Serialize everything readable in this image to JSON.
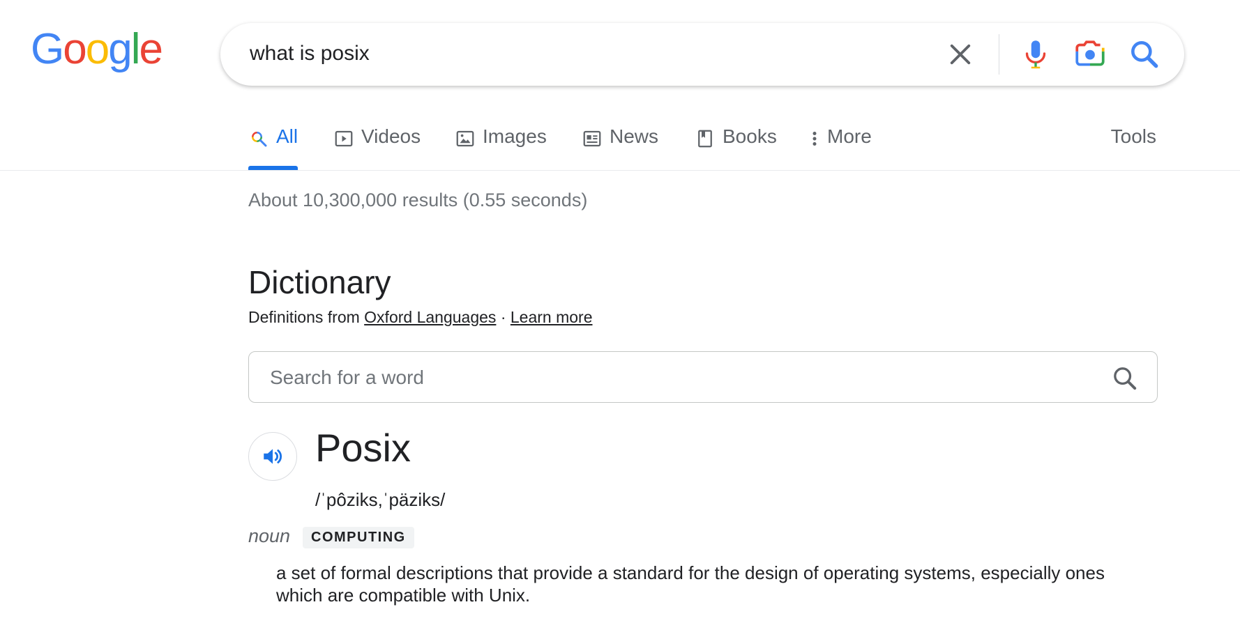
{
  "logo": {
    "text": "Google",
    "letters": [
      "G",
      "o",
      "o",
      "g",
      "l",
      "e"
    ],
    "colors": [
      "#4285F4",
      "#EA4335",
      "#FBBC05",
      "#4285F4",
      "#34A853",
      "#EA4335"
    ]
  },
  "search": {
    "query": "what is posix"
  },
  "tabs": [
    {
      "label": "All",
      "icon": "multicolor-search-icon",
      "active": true
    },
    {
      "label": "Videos",
      "icon": "play-icon"
    },
    {
      "label": "Images",
      "icon": "image-icon"
    },
    {
      "label": "News",
      "icon": "news-icon"
    },
    {
      "label": "Books",
      "icon": "book-icon"
    },
    {
      "label": "More",
      "icon": "more-vert-icon"
    }
  ],
  "tools_label": "Tools",
  "result_stats": "About 10,300,000 results (0.55 seconds)",
  "dictionary": {
    "title": "Dictionary",
    "source_prefix": "Definitions from",
    "source_link": "Oxford Languages",
    "separator": "·",
    "learn_more": "Learn more",
    "search_placeholder": "Search for a word",
    "word": "Posix",
    "phonetic": "/ˈpôziks,ˈpäziks/",
    "part_of_speech": "noun",
    "subject": "COMPUTING",
    "definition": "a set of formal descriptions that provide a standard for the design of operating systems, especially ones which are compatible with Unix."
  },
  "colors": {
    "accent": "#1a73e8",
    "text": "#202124",
    "muted": "#70757a"
  }
}
